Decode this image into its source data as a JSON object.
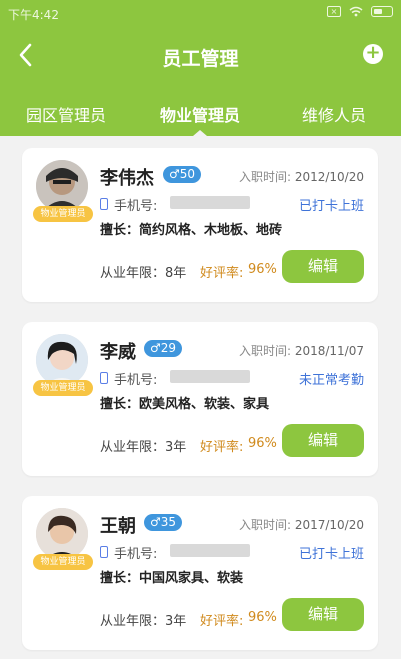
{
  "status_bar": {
    "time": "下午4:42"
  },
  "header": {
    "title": "员工管理"
  },
  "tabs": [
    {
      "label": "园区管理员"
    },
    {
      "label": "物业管理员"
    },
    {
      "label": "维修人员"
    }
  ],
  "employees": [
    {
      "name": "李伟杰",
      "gender_age": "♂50",
      "hire_label": "入职时间:",
      "hire_date": "2012/10/20",
      "phone_label": "手机号:",
      "status": "已打卡上班",
      "status_color": "#3f73d8",
      "skills": "擅长：简约风格、木地板、地砖",
      "years": "从业年限：8年",
      "rating_label": "好评率:",
      "rating": "96%",
      "edit_label": "编辑",
      "role_badge": "物业管理员"
    },
    {
      "name": "李威",
      "gender_age": "♂29",
      "hire_label": "入职时间:",
      "hire_date": "2018/11/07",
      "phone_label": "手机号:",
      "status": "未正常考勤",
      "status_color": "#3f73d8",
      "skills": "擅长：欧美风格、软装、家具",
      "years": "从业年限：3年",
      "rating_label": "好评率:",
      "rating": "96%",
      "edit_label": "编辑",
      "role_badge": "物业管理员"
    },
    {
      "name": "王朝",
      "gender_age": "♂35",
      "hire_label": "入职时间:",
      "hire_date": "2017/10/20",
      "phone_label": "手机号:",
      "status": "已打卡上班",
      "status_color": "#3f73d8",
      "skills": "擅长：中国风家具、软装",
      "years": "从业年限：3年",
      "rating_label": "好评率:",
      "rating": "96%",
      "edit_label": "编辑",
      "role_badge": "物业管理员"
    }
  ],
  "colors": {
    "brand": "#8dc63f",
    "gender_badge": "#3f96dd",
    "rating": "#d08a1d",
    "role_badge": "#f7c443"
  }
}
